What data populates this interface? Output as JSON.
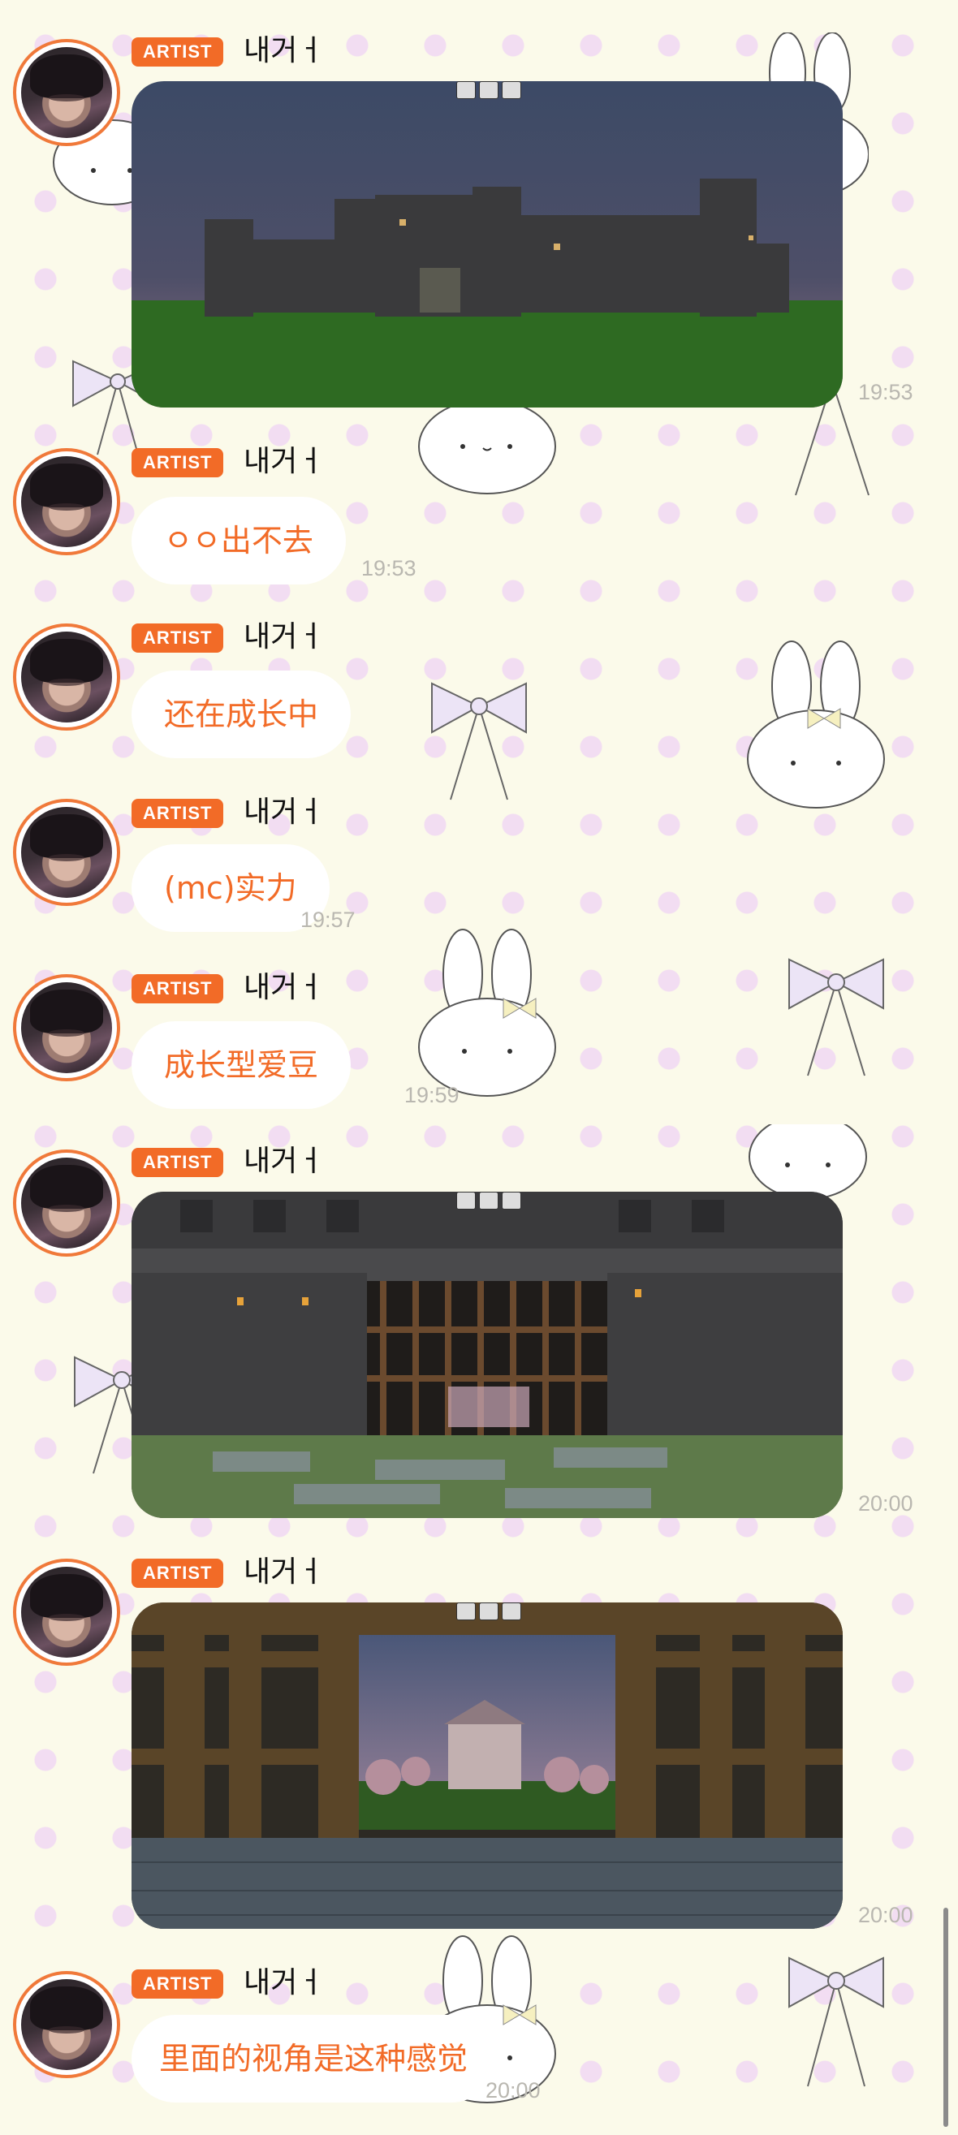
{
  "sender_name": "내거ㅓ",
  "badge_label": "ARTIST",
  "messages": [
    {
      "type": "image",
      "description_icon": "castle-screenshot",
      "time": "19:53"
    },
    {
      "type": "text",
      "text": "ㅇㅇ出不去",
      "time": "19:53"
    },
    {
      "type": "text",
      "text": "还在成长中",
      "time": ""
    },
    {
      "type": "text",
      "text": "(mc)实力",
      "time": "19:57"
    },
    {
      "type": "text",
      "text": "成长型爱豆",
      "time": "19:59"
    },
    {
      "type": "image",
      "description_icon": "castle-gate-screenshot",
      "time": "20:00"
    },
    {
      "type": "image",
      "description_icon": "castle-courtyard-screenshot",
      "time": "20:00"
    },
    {
      "type": "text",
      "text": "里面的视角是这种感觉",
      "time": "20:00"
    }
  ],
  "colors": {
    "accent": "#f26b27",
    "background": "#fbfaea",
    "dot": "#f2ddf2",
    "time": "#b9b7b0"
  }
}
